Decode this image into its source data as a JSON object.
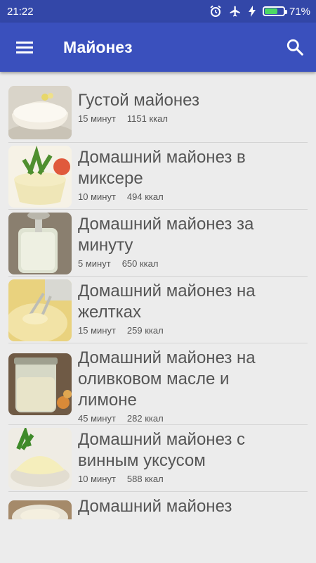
{
  "status_bar": {
    "time": "21:22",
    "battery": "71%",
    "battery_level": 0.71
  },
  "app_bar": {
    "title": "Майонез"
  },
  "recipes": [
    {
      "title": "Густой майонез",
      "time": "15 минут",
      "kcal": "1151 ккал"
    },
    {
      "title": "Домашний майонез в миксере",
      "time": "10 минут",
      "kcal": "494 ккал"
    },
    {
      "title": "Домашний майонез за минуту",
      "time": "5 минут",
      "kcal": "650 ккал"
    },
    {
      "title": "Домашний майонез на желтках",
      "time": "15 минут",
      "kcal": "259 ккал"
    },
    {
      "title": "Домашний майонез на оливковом масле и лимоне",
      "time": "45 минут",
      "kcal": "282 ккал"
    },
    {
      "title": "Домашний майонез с винным уксусом",
      "time": "10 минут",
      "kcal": "588 ккал"
    },
    {
      "title": "Домашний майонез"
    }
  ],
  "icons": {
    "menu": "menu-icon",
    "search": "search-icon",
    "alarm": "alarm-icon",
    "airplane": "airplane-icon",
    "charging": "charging-icon"
  }
}
